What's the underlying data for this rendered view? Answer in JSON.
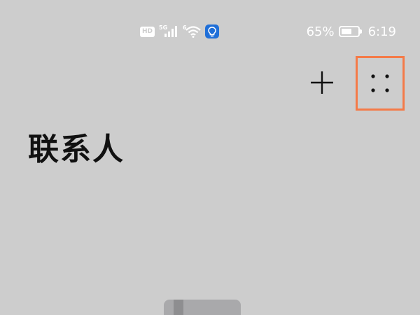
{
  "status_bar": {
    "hd_label": "HD",
    "cell_network_label": "5G",
    "wifi_network_label": "6",
    "battery_percent_text": "65%",
    "battery_level": 0.65,
    "time": "6:19"
  },
  "toolbar": {
    "add_icon": "plus-icon",
    "more_icon": "four-dots-icon"
  },
  "page": {
    "title": "联系人"
  },
  "colors": {
    "background": "#cdcdcd",
    "highlight_border": "#f47a48",
    "app_badge": "#1f6fd8",
    "icon": "#111111"
  }
}
